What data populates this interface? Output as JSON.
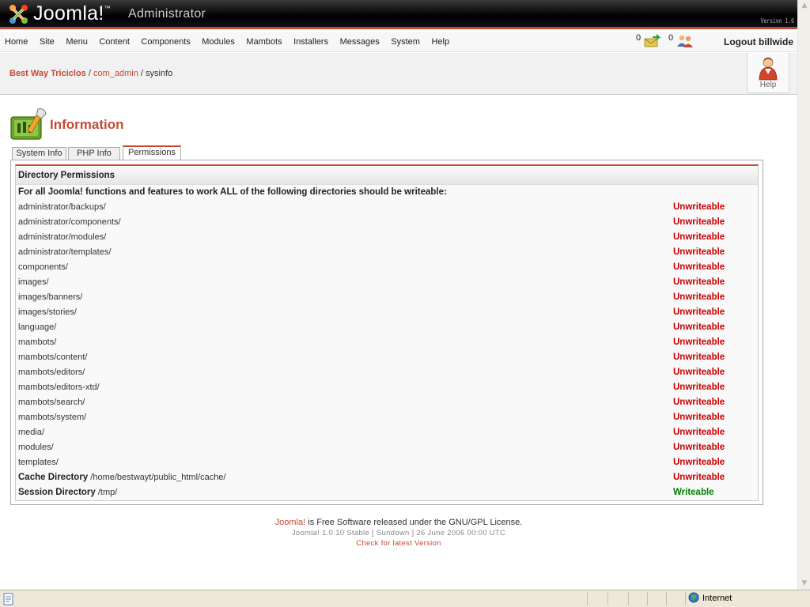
{
  "header": {
    "brand": "Joomla!",
    "trademark": "™",
    "subtitle": "Administrator",
    "version_badge": "Version 1.0"
  },
  "menu": {
    "items": [
      "Home",
      "Site",
      "Menu",
      "Content",
      "Components",
      "Modules",
      "Mambots",
      "Installers",
      "Messages",
      "System",
      "Help"
    ],
    "messages_count": "0",
    "online_users_count": "0",
    "logout_label": "Logout billwide"
  },
  "pathway": {
    "site": "Best Way Triciclos",
    "separator": " / ",
    "component": "com_admin",
    "current": "sysinfo"
  },
  "toolbar": {
    "help_label": "Help"
  },
  "page": {
    "title": "Information"
  },
  "tabs": {
    "system_info": "System Info",
    "php_info": "PHP Info",
    "permissions": "Permissions",
    "active": "Permissions"
  },
  "permissions": {
    "heading": "Directory Permissions",
    "intro": "For all Joomla! functions and features to work ALL of the following directories should be writeable:",
    "rows": [
      {
        "label": "",
        "path": "administrator/backups/",
        "status": "Unwriteable"
      },
      {
        "label": "",
        "path": "administrator/components/",
        "status": "Unwriteable"
      },
      {
        "label": "",
        "path": "administrator/modules/",
        "status": "Unwriteable"
      },
      {
        "label": "",
        "path": "administrator/templates/",
        "status": "Unwriteable"
      },
      {
        "label": "",
        "path": "components/",
        "status": "Unwriteable"
      },
      {
        "label": "",
        "path": "images/",
        "status": "Unwriteable"
      },
      {
        "label": "",
        "path": "images/banners/",
        "status": "Unwriteable"
      },
      {
        "label": "",
        "path": "images/stories/",
        "status": "Unwriteable"
      },
      {
        "label": "",
        "path": "language/",
        "status": "Unwriteable"
      },
      {
        "label": "",
        "path": "mambots/",
        "status": "Unwriteable"
      },
      {
        "label": "",
        "path": "mambots/content/",
        "status": "Unwriteable"
      },
      {
        "label": "",
        "path": "mambots/editors/",
        "status": "Unwriteable"
      },
      {
        "label": "",
        "path": "mambots/editors-xtd/",
        "status": "Unwriteable"
      },
      {
        "label": "",
        "path": "mambots/search/",
        "status": "Unwriteable"
      },
      {
        "label": "",
        "path": "mambots/system/",
        "status": "Unwriteable"
      },
      {
        "label": "",
        "path": "media/",
        "status": "Unwriteable"
      },
      {
        "label": "",
        "path": "modules/",
        "status": "Unwriteable"
      },
      {
        "label": "",
        "path": "templates/",
        "status": "Unwriteable"
      },
      {
        "label": "Cache Directory",
        "path": "/home/bestwayt/public_html/cache/",
        "status": "Unwriteable"
      },
      {
        "label": "Session Directory",
        "path": "/tmp/",
        "status": "Writeable"
      }
    ]
  },
  "footer": {
    "brand_link": "Joomla!",
    "license_text": " is Free Software released under the GNU/GPL License.",
    "version_line": "Joomla! 1.0.10 Stable [ Sundown ] 26 June 2006 00:00 UTC",
    "check_link": "Check for latest Version"
  },
  "statusbar": {
    "zone": "Internet"
  },
  "colors": {
    "accent": "#c64934",
    "unwriteable": "#cc0000",
    "writeable": "#008000"
  }
}
